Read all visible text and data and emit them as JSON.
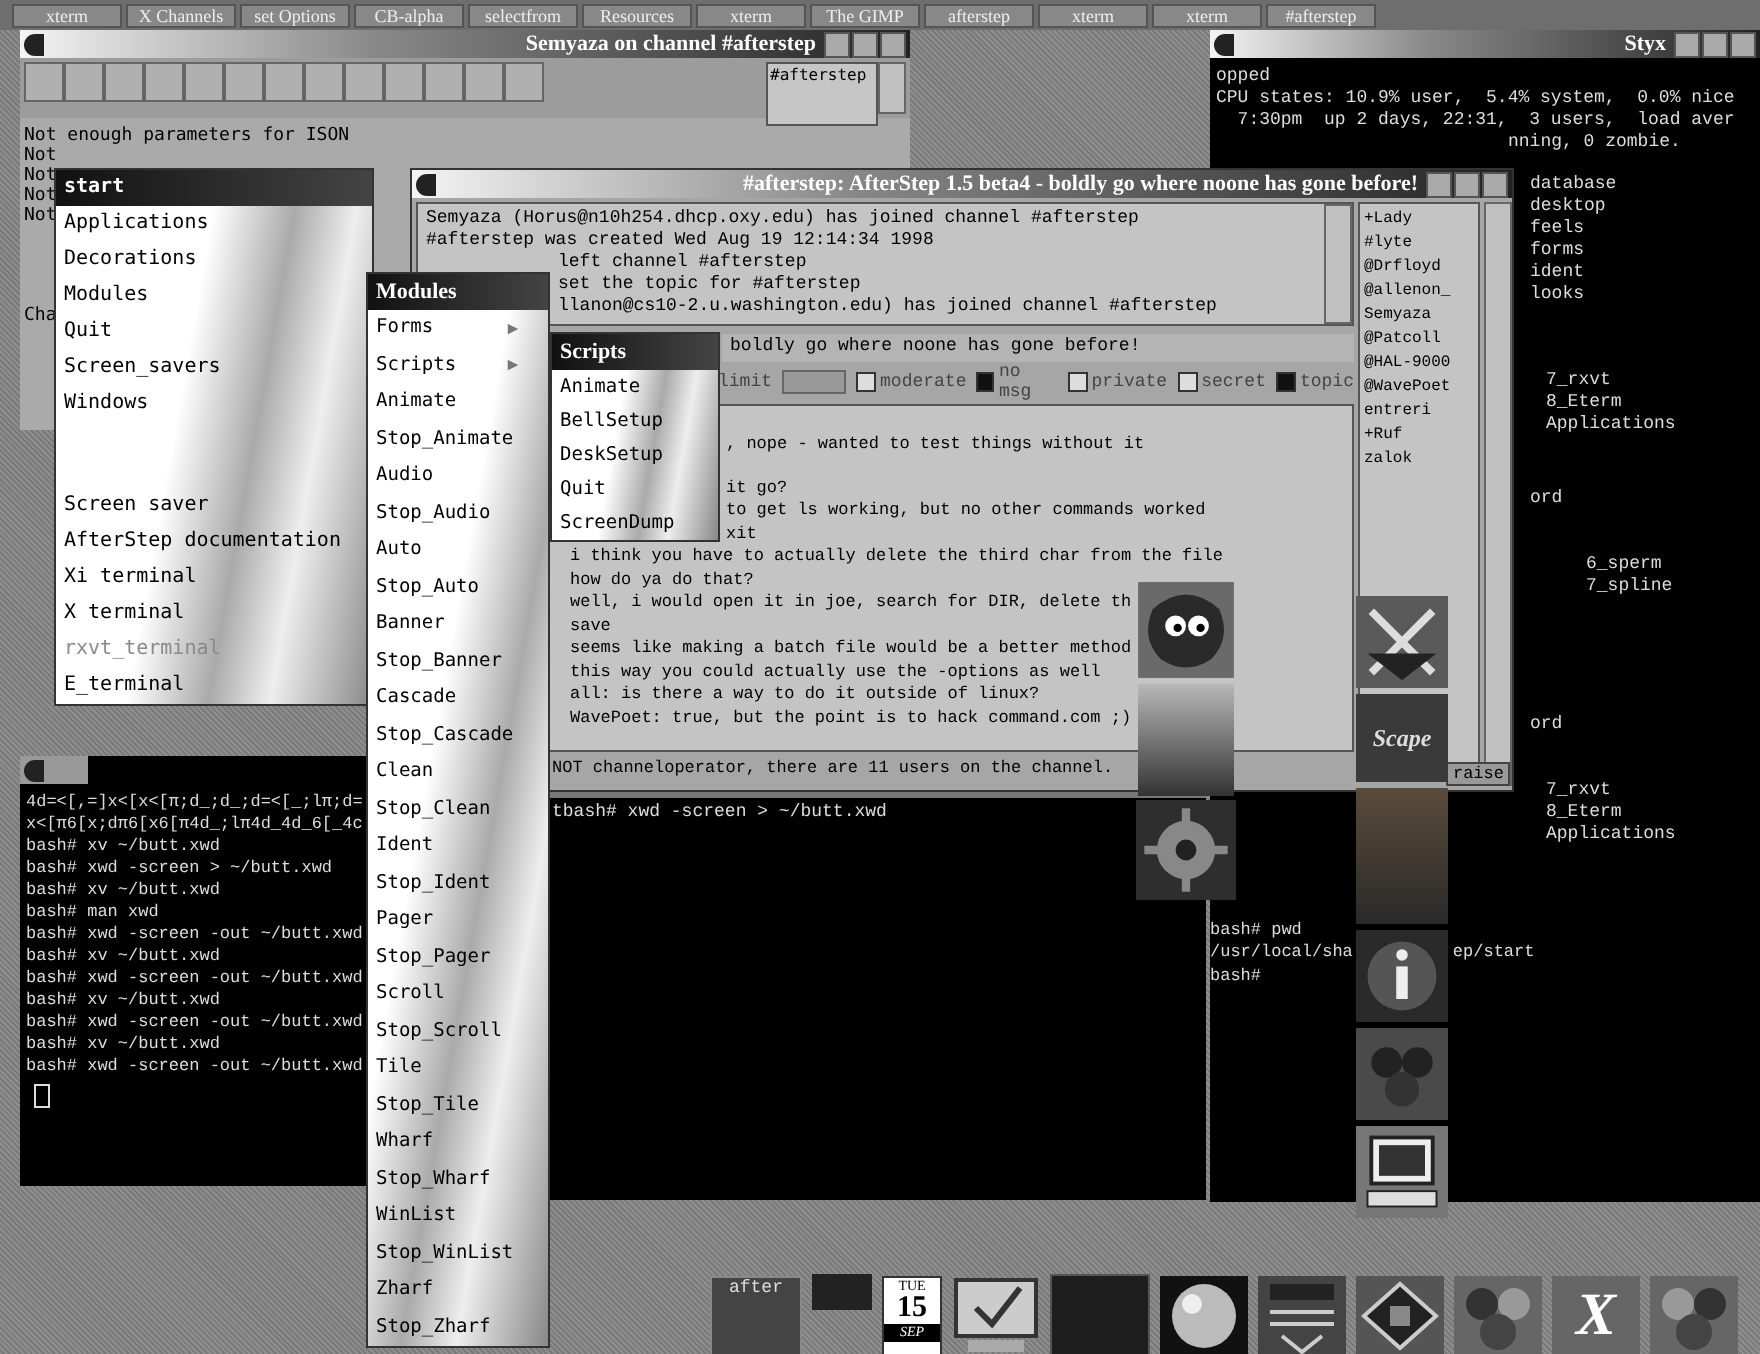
{
  "taskbar": {
    "buttons": [
      "xterm",
      "X Channels",
      "set Options",
      "CB-alpha",
      "selectfrom",
      "Resources",
      "xterm",
      "The GIMP",
      "afterstep",
      "xterm",
      "xterm",
      "#afterstep"
    ]
  },
  "irc_window": {
    "title": "Semyaza on channel #afterstep",
    "channels": [
      "#afterstep"
    ],
    "lines": [
      "Not enough parameters for ISON",
      "Not",
      "Not",
      "Not",
      "Not",
      "Cha"
    ]
  },
  "styx_window": {
    "title": "Styx",
    "lines": [
      {
        "text": "opped",
        "kind": "full"
      },
      {
        "text": "CPU states: 10.9% user,  5.4% system,  0.0% nice",
        "kind": "full"
      },
      {
        "text": "  7:30pm  up 2 days, 22:31,  3 users,  load aver",
        "kind": "full"
      },
      {
        "text": "nning, 0 zombie.",
        "kind": "partial"
      }
    ],
    "groups": [
      [
        "database",
        "desktop",
        "feels",
        "forms",
        "ident",
        "looks"
      ],
      [
        "7_rxvt",
        "8_Eterm",
        "Applications"
      ],
      [
        "ord"
      ],
      [
        "6_sperm",
        "7_spline"
      ],
      [
        "ord"
      ],
      [
        "7_rxvt",
        "8_Eterm",
        "Applications"
      ]
    ]
  },
  "channel_window": {
    "title": "#afterstep: AfterStep 1.5 beta4 - boldly go where noone has gone before!",
    "log_lines": [
      {
        "text": "Semyaza (Horus@n10h254.dhcp.oxy.edu) has joined channel #afterstep",
        "kind": "full"
      },
      {
        "text": "#afterstep was created Wed Aug 19 12:14:34 1998",
        "kind": "full"
      },
      {
        "text": "left channel #afterstep",
        "kind": "partial"
      },
      {
        "text": "set the topic for #afterstep",
        "kind": "partial"
      },
      {
        "text": "llanon@cs10-2.u.washington.edu) has joined channel #afterstep",
        "kind": "partial"
      }
    ],
    "topic": "boldly go where noone has gone before!",
    "limit_label": "limit",
    "modes": [
      {
        "label": "moderate",
        "checked": false
      },
      {
        "label": "no msg",
        "checked": true
      },
      {
        "label": "private",
        "checked": false
      },
      {
        "label": "secret",
        "checked": false
      },
      {
        "label": "topic",
        "checked": true
      }
    ],
    "chat_lines": [
      {
        "text": ", nope - wanted to test things without it",
        "kind": "partial"
      },
      {
        "text": "it go?",
        "kind": "partial"
      },
      {
        "text": "to get ls working, but no other commands worked",
        "kind": "partial"
      },
      {
        "text": "xit",
        "kind": "partial"
      },
      {
        "text": "i think you have to actually delete the third char from the file",
        "kind": "full"
      },
      {
        "text": "how do ya do that?",
        "kind": "full"
      },
      {
        "text": "well, i would open it in joe, search for DIR, delete th",
        "kind": "full"
      },
      {
        "text": "save",
        "kind": "full"
      },
      {
        "text": "seems like making a batch file would be a better method",
        "kind": "full"
      },
      {
        "text": "this way you could actually use the -options as well",
        "kind": "full"
      },
      {
        "text": "all: is there a way to do it outside of linux?",
        "kind": "full"
      },
      {
        "text": "WavePoet: true, but the point is to hack command.com ;)",
        "kind": "full"
      }
    ],
    "status": "NOT channeloperator, there are 11 users on the channel.",
    "nicks": [
      "+Lady",
      "#lyte",
      "@Drfloyd",
      "@allenon_",
      "Semyaza",
      "@Patcoll",
      "@HAL-9000",
      "@WavePoet",
      "entreri",
      "+Ruf",
      "zalok"
    ],
    "raise_button": "raise"
  },
  "start_menu": {
    "title": "start",
    "items": [
      {
        "label": "Applications",
        "disabled": false
      },
      {
        "label": "Decorations",
        "disabled": false
      },
      {
        "label": "Modules",
        "disabled": false
      },
      {
        "label": "Quit",
        "disabled": false
      },
      {
        "label": "Screen_savers",
        "disabled": false
      },
      {
        "label": "Windows",
        "disabled": false
      }
    ],
    "extra_items": [
      {
        "label": "Screen saver",
        "disabled": false
      },
      {
        "label": "AfterStep documentation",
        "disabled": false
      },
      {
        "label": "Xi terminal",
        "disabled": false
      },
      {
        "label": "X terminal",
        "disabled": false
      },
      {
        "label": "rxvt_terminal",
        "disabled": true
      },
      {
        "label": "E_terminal",
        "disabled": false
      }
    ]
  },
  "modules_menu": {
    "title": "Modules",
    "items": [
      {
        "label": "Forms",
        "submenu": true
      },
      {
        "label": "Scripts",
        "submenu": true
      },
      {
        "label": "Animate",
        "submenu": false
      },
      {
        "label": "Stop_Animate",
        "submenu": false
      },
      {
        "label": "Audio",
        "submenu": false
      },
      {
        "label": "Stop_Audio",
        "submenu": false
      },
      {
        "label": "Auto",
        "submenu": false
      },
      {
        "label": "Stop_Auto",
        "submenu": false
      },
      {
        "label": "Banner",
        "submenu": false
      },
      {
        "label": "Stop_Banner",
        "submenu": false
      },
      {
        "label": "Cascade",
        "submenu": false
      },
      {
        "label": "Stop_Cascade",
        "submenu": false
      },
      {
        "label": "Clean",
        "submenu": false
      },
      {
        "label": "Stop_Clean",
        "submenu": false
      },
      {
        "label": "Ident",
        "submenu": false
      },
      {
        "label": "Stop_Ident",
        "submenu": false
      },
      {
        "label": "Pager",
        "submenu": false
      },
      {
        "label": "Stop_Pager",
        "submenu": false
      },
      {
        "label": "Scroll",
        "submenu": false
      },
      {
        "label": "Stop_Scroll",
        "submenu": false
      },
      {
        "label": "Tile",
        "submenu": false
      },
      {
        "label": "Stop_Tile",
        "submenu": false
      },
      {
        "label": "Wharf",
        "submenu": false
      },
      {
        "label": "Stop_Wharf",
        "submenu": false
      },
      {
        "label": "WinList",
        "submenu": false
      },
      {
        "label": "Stop_WinList",
        "submenu": false
      },
      {
        "label": "Zharf",
        "submenu": false
      },
      {
        "label": "Stop_Zharf",
        "submenu": false
      }
    ]
  },
  "scripts_menu": {
    "title": "Scripts",
    "items": [
      "Animate",
      "BellSetup",
      "DeskSetup",
      "Quit",
      "ScreenDump"
    ]
  },
  "left_terminal": {
    "lines": [
      "4d=<[,=]x<[x<[π;d_;d_;d=<[_;lπ;d=",
      "x<[π6[x;dπ6[x6[π4d_;lπ4d_4d_6[_4c",
      "bash# xv ~/butt.xwd",
      "bash# xwd -screen > ~/butt.xwd",
      "bash# xv ~/butt.xwd",
      "bash# man xwd",
      "bash# xwd -screen -out ~/butt.xwd",
      "bash# xv ~/butt.xwd",
      "bash# xwd -screen -out ~/butt.xwd",
      "bash# xv ~/butt.xwd",
      "bash# xwd -screen -out ~/butt.xwd",
      "bash# xv ~/butt.xwd",
      "bash# xwd -screen -out ~/butt.xwd"
    ]
  },
  "middle_terminal": {
    "lines": [
      "tbash# xwd -screen > ~/butt.xwd"
    ]
  },
  "right_terminal": {
    "lines": [
      [
        "bash# pwd"
      ],
      [
        "/usr/local/sha",
        "ep/start"
      ],
      [
        "bash#"
      ]
    ]
  },
  "wharf": {
    "label": "Scape"
  },
  "dock": {
    "logo": "after",
    "calendar": {
      "day": "TUE",
      "date": "15",
      "month": "SEP"
    },
    "x_logo": "X"
  }
}
